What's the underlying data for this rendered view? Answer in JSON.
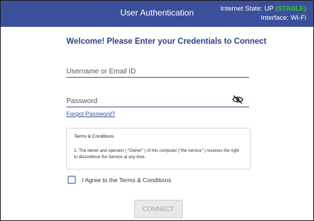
{
  "header": {
    "title": "User Authentication",
    "internet_state_label": "Internet State: UP",
    "internet_state_status": "(STABLE)",
    "interface_label": "Interface:",
    "interface_value": "Wi-Fi",
    "background_color": "#3b4f9a",
    "status_color": "#32c832"
  },
  "form": {
    "welcome": "Welcome! Please Enter your Credentials to Connect",
    "username_placeholder": "Username or Email ID",
    "username_value": "",
    "password_placeholder": "Password",
    "password_value": "",
    "password_toggle_icon": "eye-slash-icon",
    "forgot_password": "Forgot Password?",
    "terms": {
      "title": "Terms & Conditions",
      "text": "1. The owner and operator ( \"Owner\" ) of this computer (\"the service\" ) receives the right to discontinue the Service at any time."
    },
    "agree_label": "I Agree to the Terms & Conditions",
    "agree_checked": false,
    "connect_label": "CONNECT",
    "connect_enabled": false
  }
}
